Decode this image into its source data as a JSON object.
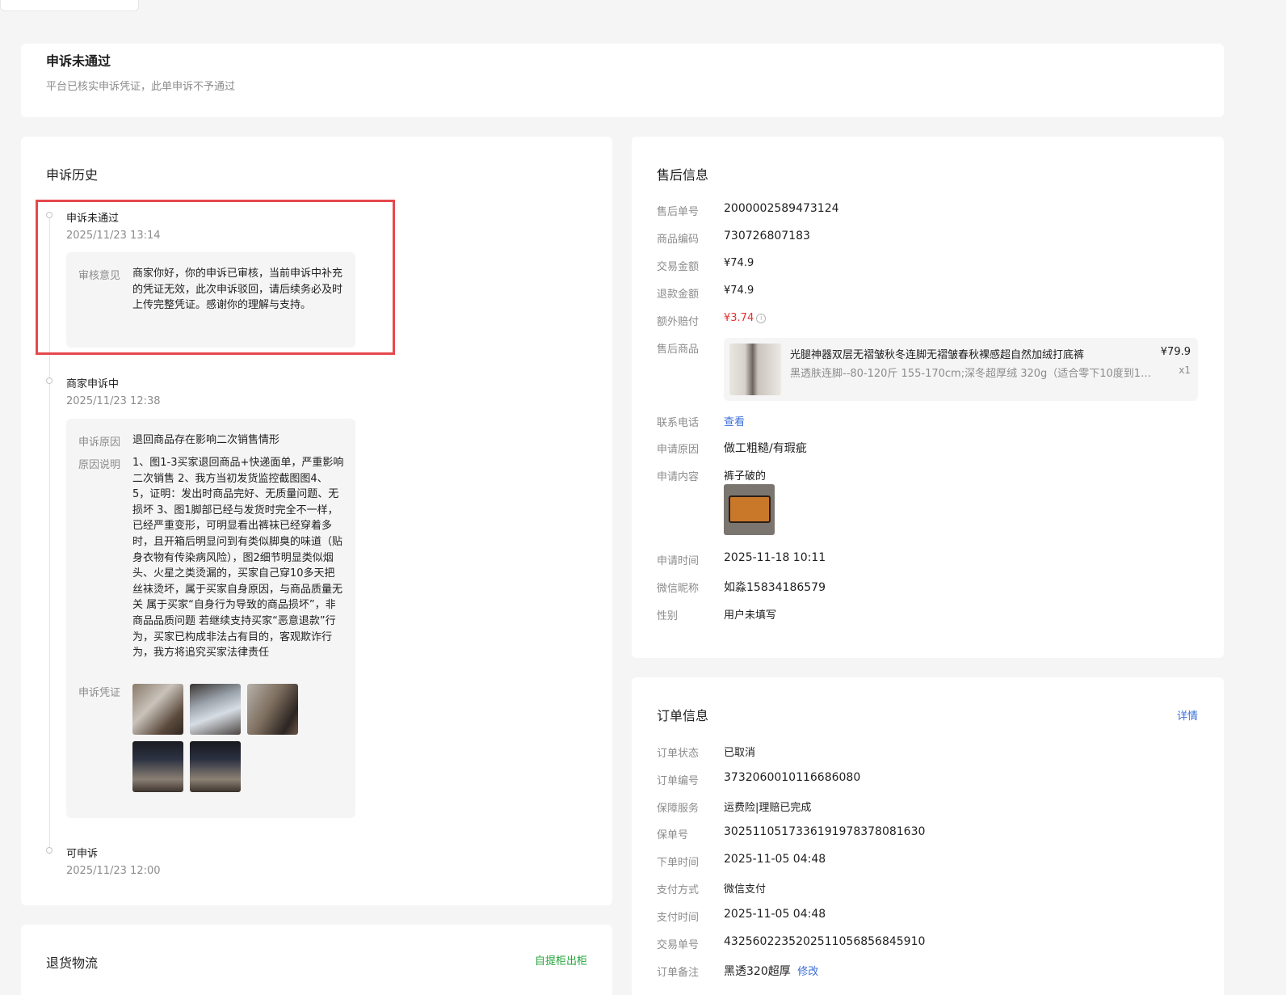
{
  "status": {
    "title": "申诉未通过",
    "desc": "平台已核实申诉凭证，此单申诉不予通过"
  },
  "history": {
    "title": "申诉历史",
    "entries": [
      {
        "title": "申诉未通过",
        "time": "2025/11/23 13:14",
        "review_label": "审核意见",
        "review_text": "商家你好，你的申诉已审核，当前申诉中补充的凭证无效，此次申诉驳回，请后续务必及时上传完整凭证。感谢你的理解与支持。"
      },
      {
        "title": "商家申诉中",
        "time": "2025/11/23 12:38",
        "reason_label": "申诉原因",
        "reason": "退回商品存在影响二次销售情形",
        "explain_label": "原因说明",
        "explain": "1、图1-3买家退回商品+快递面单，严重影响二次销售 2、我方当初发货监控截图图4、5，证明：发出时商品完好、无质量问题、无损坏 3、图1脚部已经与发货时完全不一样，已经严重变形，可明显看出裤袜已经穿着多时，且开箱后明显问到有类似脚臭的味道（贴身衣物有传染病风险），图2细节明显类似烟头、火星之类烫漏的，买家自己穿10多天把丝袜烫坏，属于买家自身原因，与商品质量无关 属于买家“自身行为导致的商品损坏”，非商品品质问题 若继续支持买家“恶意退款”行为，买家已构成非法占有目的，客观欺诈行为，我方将追究买家法律责任",
        "evidence_label": "申诉凭证"
      },
      {
        "title": "可申诉",
        "time": "2025/11/23 12:00"
      }
    ]
  },
  "logistics": {
    "title": "退货物流",
    "status": "自提柜出柜"
  },
  "aftersale": {
    "title": "售后信息",
    "rows": [
      {
        "label": "售后单号",
        "value": "2000002589473124"
      },
      {
        "label": "商品编码",
        "value": "730726807183"
      },
      {
        "label": "交易金额",
        "value": "¥74.9"
      },
      {
        "label": "退款金额",
        "value": "¥74.9"
      },
      {
        "label": "额外赔付",
        "value": "¥3.74"
      },
      {
        "label": "售后商品",
        "value": ""
      },
      {
        "label": "联系电话",
        "value": "查看"
      },
      {
        "label": "申请原因",
        "value": "做工粗糙/有瑕疵"
      },
      {
        "label": "申请内容",
        "value": "裤子破的"
      },
      {
        "label": "申请时间",
        "value": "2025-11-18 10:11"
      },
      {
        "label": "微信昵称",
        "value": "如淼15834186579"
      },
      {
        "label": "性别",
        "value": "用户未填写"
      }
    ],
    "product": {
      "name": "光腿神器双层无褶皱秋冬连脚无褶皱春秋裸感超自然加绒打底裤",
      "spec": "黑透肤连脚--80-120斤 155-170cm;深冬超厚绒 320g（适合零下10度到1…",
      "price": "¥79.9",
      "qty": "x1"
    }
  },
  "order": {
    "title": "订单信息",
    "detail_link": "详情",
    "rows": [
      {
        "label": "订单状态",
        "value": "已取消"
      },
      {
        "label": "订单编号",
        "value": "3732060010116686080"
      },
      {
        "label": "保障服务",
        "value": "运费险|理赔已完成"
      },
      {
        "label": "保单号",
        "value": "3025110517336191978378081630"
      },
      {
        "label": "下单时间",
        "value": "2025-11-05 04:48"
      },
      {
        "label": "支付方式",
        "value": "微信支付"
      },
      {
        "label": "支付时间",
        "value": "2025-11-05 04:48"
      },
      {
        "label": "交易单号",
        "value": "4325602235202511056856845910"
      },
      {
        "label": "订单备注",
        "value": "黑透320超厚"
      }
    ],
    "remark_edit": "修改"
  },
  "colors": {
    "accent_link": "#3b6fd8",
    "success": "#22a53a",
    "danger": "#e5302f",
    "highlight_border": "#e5484d"
  }
}
